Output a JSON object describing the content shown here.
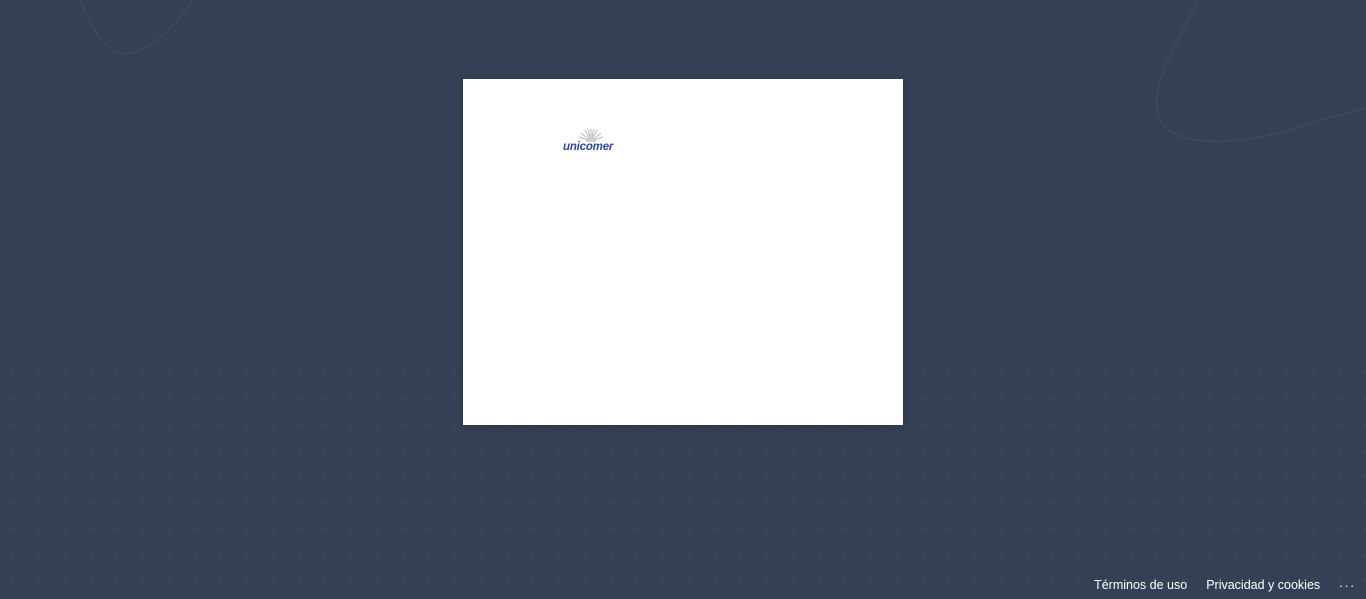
{
  "logo": {
    "text": "unicomer",
    "brand_color": "#2f4a9a"
  },
  "footer": {
    "terms_label": "Términos de uso",
    "privacy_label": "Privacidad y cookies",
    "more_label": "..."
  },
  "colors": {
    "background": "#334055",
    "card": "#ffffff"
  }
}
